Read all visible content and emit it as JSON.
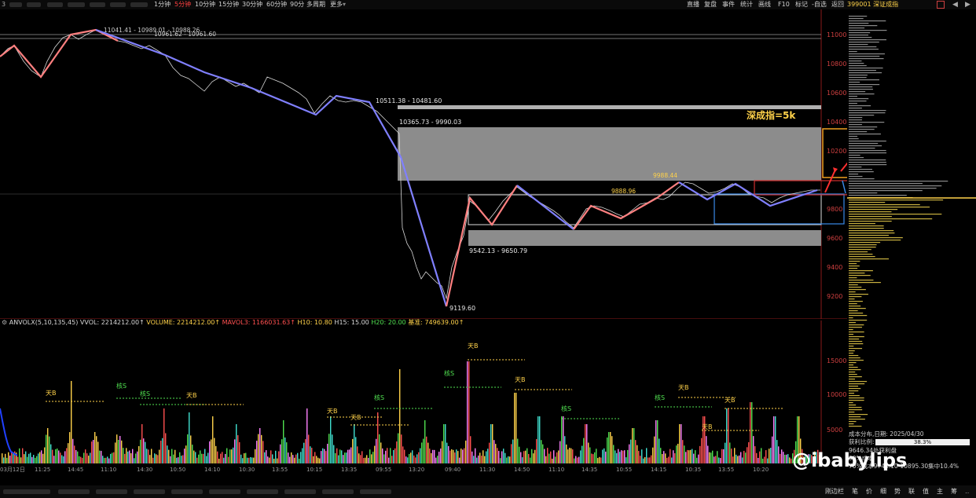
{
  "top_bar": {
    "timeframes": [
      "1分钟",
      "5分钟",
      "10分钟",
      "15分钟",
      "30分钟",
      "60分钟",
      "90分",
      "多周期",
      "更多"
    ],
    "active_timeframe_index": 1,
    "tools": [
      "直播",
      "复盘",
      "事件",
      "统计",
      "画线",
      "F10",
      "标记",
      "-自选",
      "返回"
    ],
    "symbol": "399001 深证成指"
  },
  "price_chart": {
    "tick_labels": [
      "11000",
      "10800",
      "10600",
      "10400",
      "10200",
      "9800",
      "9600",
      "9400",
      "9200"
    ],
    "annotations": {
      "high_range": "11041.41 - 10989.01 - 10988.26",
      "high_range_2": "10961.62 - 10961.60",
      "zone1": "10511.38 - 10481.60",
      "zone2": "10365.73 - 9990.03",
      "low_zone": "9542.13 - 9650.79",
      "low_point": "9119.60",
      "level_1": "9888.96",
      "level_2": "9988.44",
      "target_note": "深成指=5k"
    }
  },
  "indicator_header": {
    "name": "ANVOLX(5,10,135,45)",
    "vvol": "VVOL: 2214212.00↑",
    "volume": "VOLUME: 2214212.00↑",
    "mavol3": "MAVOL3: 1166031.63↑",
    "h10": "H10: 10.80",
    "h15": "H15: 15.00",
    "h20": "H20: 20.00",
    "base": "基准: 749639.00↑"
  },
  "volume_chart": {
    "tick_labels": [
      "15000",
      "10000",
      "5000"
    ],
    "signals": [
      "天B",
      "核S",
      "核S",
      "天B",
      "天B",
      "天B",
      "核S",
      "天B",
      "核S",
      "天B",
      "核S",
      "核S",
      "天B",
      "天B",
      "天B"
    ]
  },
  "time_axis": [
    "03月12日",
    "11:25",
    "14:45",
    "11:10",
    "14:30",
    "10:50",
    "14:10",
    "10:30",
    "13:55",
    "10:15",
    "13:35",
    "09:55",
    "13:20",
    "09:40",
    "11:30",
    "14:50",
    "11:10",
    "14:35",
    "10:55",
    "14:15",
    "10:35",
    "13:55",
    "10:20"
  ],
  "info_box": {
    "title": "成本分布,日期: 2025/04/30",
    "ratio_label": "获利比例:",
    "ratio_value": "38.3%",
    "avg_cost": "9646.34处获利盘",
    "line90": "90%成本",
    "line70": "70%成本9746.10-10895.30集中10.4%"
  },
  "bottom_bar": {
    "tabs": [
      "笔",
      "价",
      "细",
      "势",
      "联",
      "值",
      "主",
      "筹"
    ],
    "status": "刚边栏"
  },
  "watermark": "@ibabylips"
}
